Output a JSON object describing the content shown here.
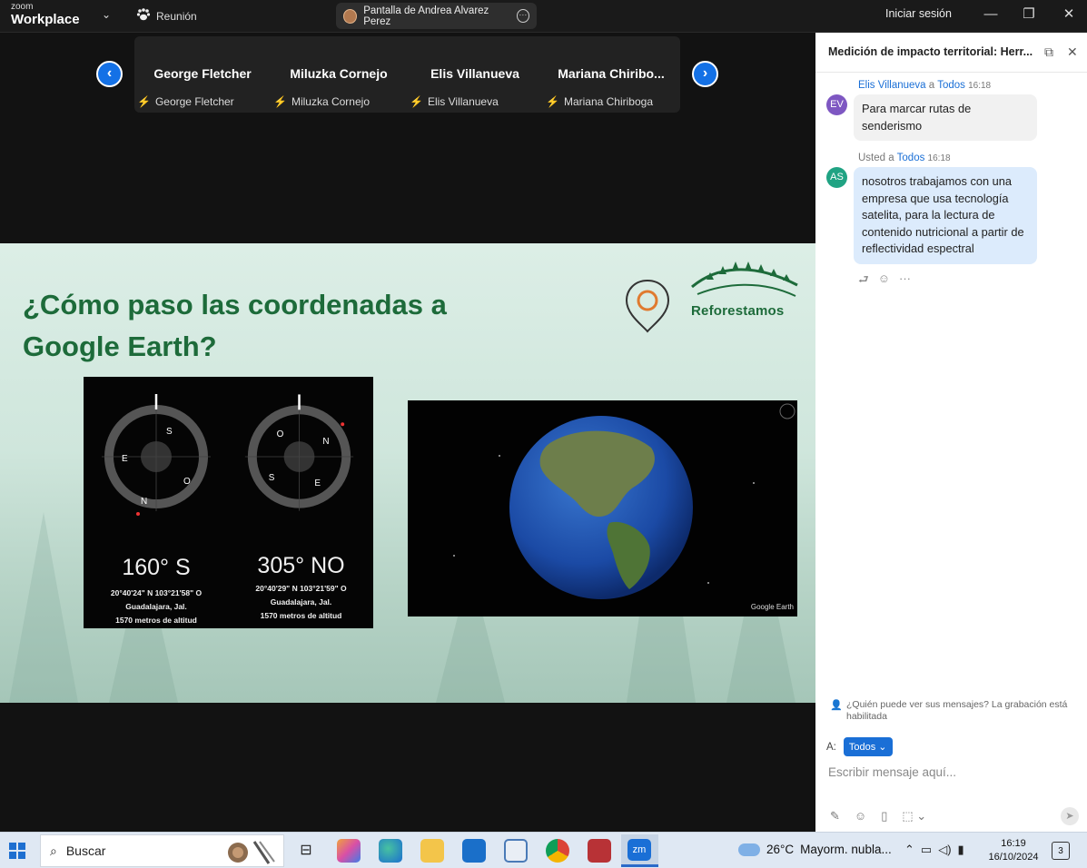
{
  "titlebar": {
    "brand_small": "zoom",
    "brand": "Workplace",
    "meeting_label": "Reunión",
    "share_label": "Pantalla de Andrea Alvarez Perez",
    "signin_label": "Iniciar sesión"
  },
  "gallery": {
    "participants": [
      {
        "name": "George Fletcher",
        "label": "George Fletcher"
      },
      {
        "name": "Miluzka Cornejo",
        "label": "Miluzka Cornejo"
      },
      {
        "name": "Elis Villanueva",
        "label": "Elis Villanueva"
      },
      {
        "name": "Mariana  Chiribo...",
        "label": "Mariana Chiriboga"
      }
    ]
  },
  "slide": {
    "title": "¿Cómo paso las coordenadas a Google Earth?",
    "logo_text": "Reforestamos",
    "compass_left": {
      "degree": "160° S",
      "coords": "20°40'24\" N  103°21'58\" O",
      "place": "Guadalajara, Jal.",
      "altitude": "1570 metros de altitud"
    },
    "compass_right": {
      "degree": "305° NO",
      "coords": "20°40'29\" N  103°21'59\" O",
      "place": "Guadalajara, Jal.",
      "altitude": "1570 metros de altitud"
    },
    "earth_label": "Google Earth"
  },
  "chat": {
    "title": "Medición de impacto territorial: Herr...",
    "messages": [
      {
        "initials": "EV",
        "avatar_color": "#7e57c2",
        "sender": "Elis Villanueva",
        "connector": "a",
        "recipient": "Todos",
        "time": "16:18",
        "text": "Para marcar rutas de senderismo",
        "bubble_color": "#f1f1f1"
      },
      {
        "initials": "AS",
        "avatar_color": "#20a383",
        "sender": "Usted",
        "connector": "a",
        "recipient": "Todos",
        "time": "16:18",
        "text": "nosotros trabajamos con una empresa que usa tecnología satelita, para la lectura de contenido nutricional a partir de reflectividad espectral",
        "bubble_color": "#dcebfc"
      }
    ],
    "privacy_note": "¿Quién puede ver sus mensajes? La grabación está habilitada",
    "to_label": "A:",
    "to_value": "Todos",
    "input_placeholder": "Escribir mensaje aquí..."
  },
  "taskbar": {
    "search_label": "Buscar",
    "weather": "26°C",
    "weather_desc": "Mayorm. nubla...",
    "time": "16:19",
    "date": "16/10/2024",
    "notif_count": "3",
    "accent": "#2b6ac9"
  }
}
